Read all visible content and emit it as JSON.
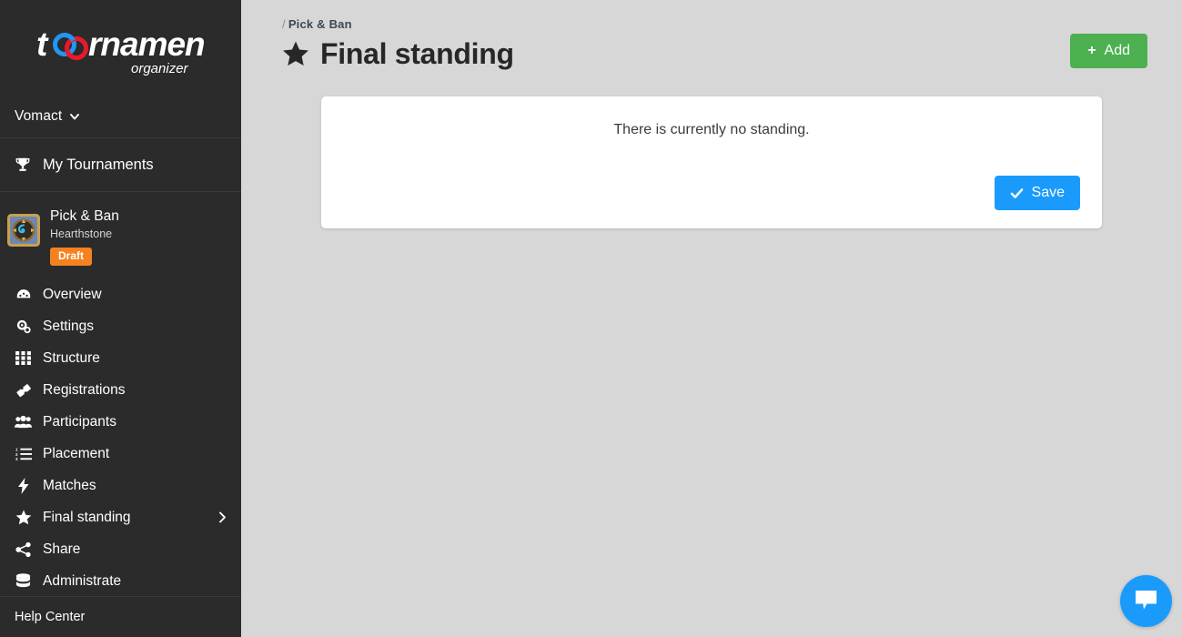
{
  "brand": {
    "logo_text": "tournament",
    "logo_sub": "organizer",
    "ring_blue": "#2196f3",
    "ring_red": "#e8192c"
  },
  "sidebar": {
    "account": {
      "name": "Vomact",
      "chevron_icon": "chevron-down-icon"
    },
    "my_tournaments": {
      "label": "My Tournaments",
      "icon": "trophy-icon"
    },
    "tournament": {
      "name": "Pick & Ban",
      "game": "Hearthstone",
      "status_badge": "Draft",
      "badge_color": "#f5821f",
      "thumb_icon": "hearthstone-icon"
    },
    "items": [
      {
        "label": "Overview",
        "icon": "dashboard-icon",
        "chevron": false
      },
      {
        "label": "Settings",
        "icon": "cogs-icon",
        "chevron": false
      },
      {
        "label": "Structure",
        "icon": "grid-icon",
        "chevron": false
      },
      {
        "label": "Registrations",
        "icon": "ticket-icon",
        "chevron": false
      },
      {
        "label": "Participants",
        "icon": "users-icon",
        "chevron": false
      },
      {
        "label": "Placement",
        "icon": "ordered-list-icon",
        "chevron": false
      },
      {
        "label": "Matches",
        "icon": "bolt-icon",
        "chevron": false
      },
      {
        "label": "Final standing",
        "icon": "star-icon",
        "chevron": true
      },
      {
        "label": "Share",
        "icon": "share-icon",
        "chevron": false
      },
      {
        "label": "Administrate",
        "icon": "database-icon",
        "chevron": false
      }
    ],
    "footer": {
      "help_center": "Help Center"
    }
  },
  "header": {
    "breadcrumb_sep": "/",
    "breadcrumb": "Pick & Ban",
    "title": "Final standing",
    "title_icon": "star-icon",
    "add_button": {
      "label": "Add",
      "plus": "+",
      "color": "#4cb050"
    }
  },
  "main": {
    "empty_message": "There is currently no standing.",
    "save_button": {
      "label": "Save",
      "icon": "check-icon",
      "color": "#1a9bfc"
    }
  },
  "widgets": {
    "chat": {
      "icon": "chat-bubble-icon",
      "color": "#1a9bfc"
    }
  }
}
